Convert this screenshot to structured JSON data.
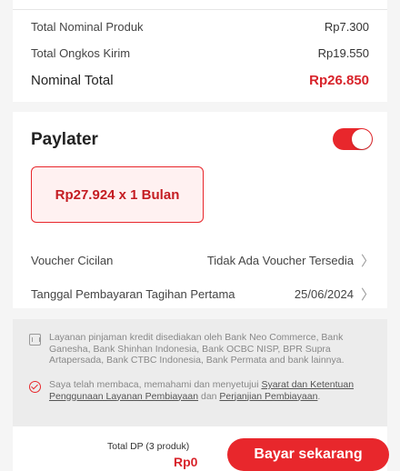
{
  "summary": {
    "product_label": "Total Nominal Produk",
    "product_value": "Rp7.300",
    "shipping_label": "Total Ongkos Kirim",
    "shipping_value": "Rp19.550",
    "total_label": "Nominal Total",
    "total_value": "Rp26.850"
  },
  "paylater": {
    "title": "Paylater",
    "toggle_on": true,
    "plan": "Rp27.924 x 1 Bulan",
    "voucher_label": "Voucher Cicilan",
    "voucher_value": "Tidak Ada Voucher Tersedia",
    "first_payment_label": "Tanggal Pembayaran Tagihan Pertama",
    "first_payment_value": "25/06/2024"
  },
  "info": {
    "banks_note": "Layanan pinjaman kredit disediakan oleh Bank Neo Commerce, Bank Ganesha, Bank Shinhan Indonesia, Bank OCBC NISP, BPR Supra Artapersada, Bank CTBC Indonesia, Bank Permata and bank lainnya.",
    "consent_prefix": "Saya telah membaca, memahami dan menyetujui ",
    "consent_link1": "Syarat dan Ketentuan Penggunaan Layanan Pembiayaan",
    "consent_mid": " dan ",
    "consent_link2": "Perjanjian Pembiayaan",
    "consent_suffix": "."
  },
  "footer": {
    "dp_label": "Total DP (3 produk)",
    "dp_value": "Rp0",
    "pay_button": "Bayar sekarang"
  },
  "colors": {
    "accent": "#e8272c",
    "price_red": "#d8232a"
  },
  "icons": {
    "bank": "bank-icon",
    "check": "check-circle-icon",
    "chevron": "chevron-right-icon"
  }
}
